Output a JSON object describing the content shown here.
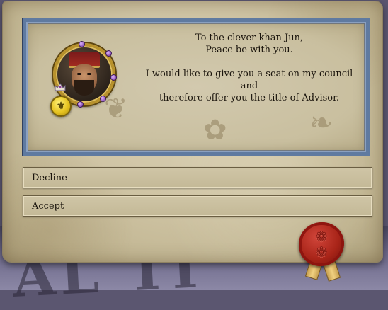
{
  "letter": {
    "line1": "To the clever khan Jun,",
    "line2": "Peace be with you.",
    "line3": "I would like to give you a seat on my council and",
    "line4": "therefore offer you the title of Advisor."
  },
  "options": {
    "decline_label": "Decline",
    "accept_label": "Accept"
  },
  "portrait": {
    "icon": "character-portrait",
    "rank_icon": "crown-icon",
    "coat_of_arms_icon": "gold-coin-icon"
  },
  "seal": {
    "icon": "wax-seal-icon"
  },
  "colors": {
    "parchment": "#cfc4a4",
    "frame_blue": "#5f7aa0",
    "seal_red": "#a82418",
    "portrait_gold": "#b8922c"
  }
}
